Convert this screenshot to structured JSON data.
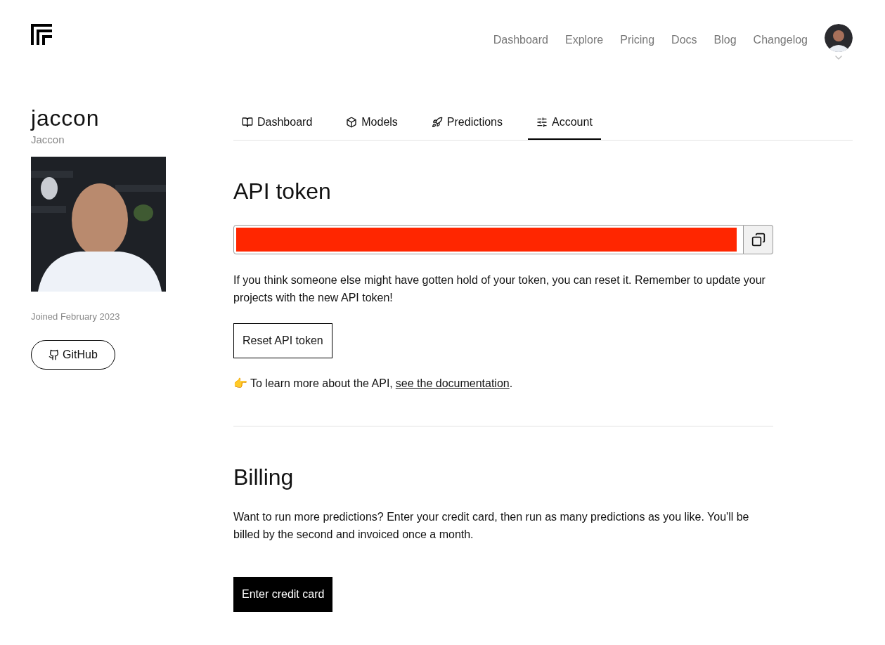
{
  "nav": {
    "links": [
      "Dashboard",
      "Explore",
      "Pricing",
      "Docs",
      "Blog",
      "Changelog"
    ]
  },
  "profile": {
    "username": "jaccon",
    "display_name": "Jaccon",
    "joined": "Joined February 2023",
    "github_button": "GitHub"
  },
  "tabs": [
    {
      "label": "Dashboard",
      "selected": false
    },
    {
      "label": "Models",
      "selected": false
    },
    {
      "label": "Predictions",
      "selected": false
    },
    {
      "label": "Account",
      "selected": true
    }
  ],
  "api_token": {
    "heading": "API token",
    "description": "If you think someone else might have gotten hold of your token, you can reset it. Remember to update your projects with the new API token!",
    "reset_button": "Reset API token",
    "hint_emoji": "👉",
    "hint_text": "To learn more about the API,",
    "hint_link": "see the documentation",
    "hint_end": "."
  },
  "billing": {
    "heading": "Billing",
    "description": "Want to run more predictions? Enter your credit card, then run as many predictions as you like. You'll be billed by the second and invoiced once a month.",
    "button": "Enter credit card"
  }
}
